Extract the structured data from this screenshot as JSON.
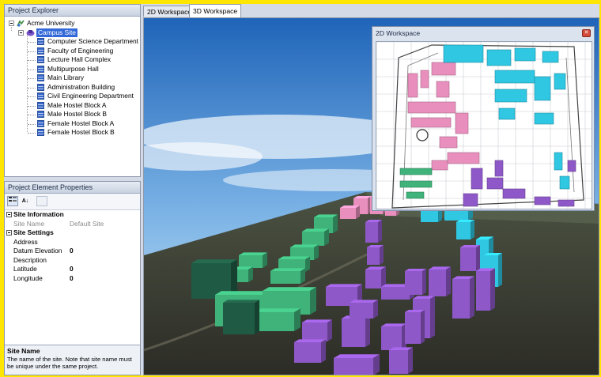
{
  "explorer": {
    "title": "Project Explorer",
    "root": "Acme University",
    "site": "Campus Site",
    "buildings": [
      "Computer Science Department",
      "Faculty of Engineering",
      "Lecture Hall Complex",
      "Multipurpose Hall",
      "Main Library",
      "Administration Building",
      "Civil Engineering Department",
      "Male Hostel Block A",
      "Male Hostel Block B",
      "Female Hostel Block A",
      "Female Hostel Block B"
    ]
  },
  "properties": {
    "title": "Project Element Properties",
    "toolbar": {
      "categorized_icon": "categorized-icon",
      "alphabetical_icon": "sort-az-icon",
      "pages_icon": "property-pages-icon"
    },
    "categories": [
      {
        "name": "Site Information",
        "rows": [
          {
            "key": "Site Name",
            "value": "Default Site",
            "dim": true
          }
        ]
      },
      {
        "name": "Site Settings",
        "rows": [
          {
            "key": "Address",
            "value": ""
          },
          {
            "key": "Datum Elevation",
            "value": "0"
          },
          {
            "key": "Description",
            "value": ""
          },
          {
            "key": "Latitude",
            "value": "0"
          },
          {
            "key": "Longitude",
            "value": "0"
          }
        ]
      }
    ],
    "help": {
      "title": "Site Name",
      "text": "The name of the site. Note that site name must be unique under the same project."
    }
  },
  "workspace": {
    "tabs": [
      "2D Workspace",
      "3D Workspace"
    ],
    "active_tab": "3D Workspace",
    "floating_window_title": "2D Workspace",
    "colors": {
      "pink": "#e98fbd",
      "cyan": "#2fc7e2",
      "purple": "#8f58c9",
      "green": "#3fb37a",
      "dark_green": "#1f5b44"
    }
  }
}
